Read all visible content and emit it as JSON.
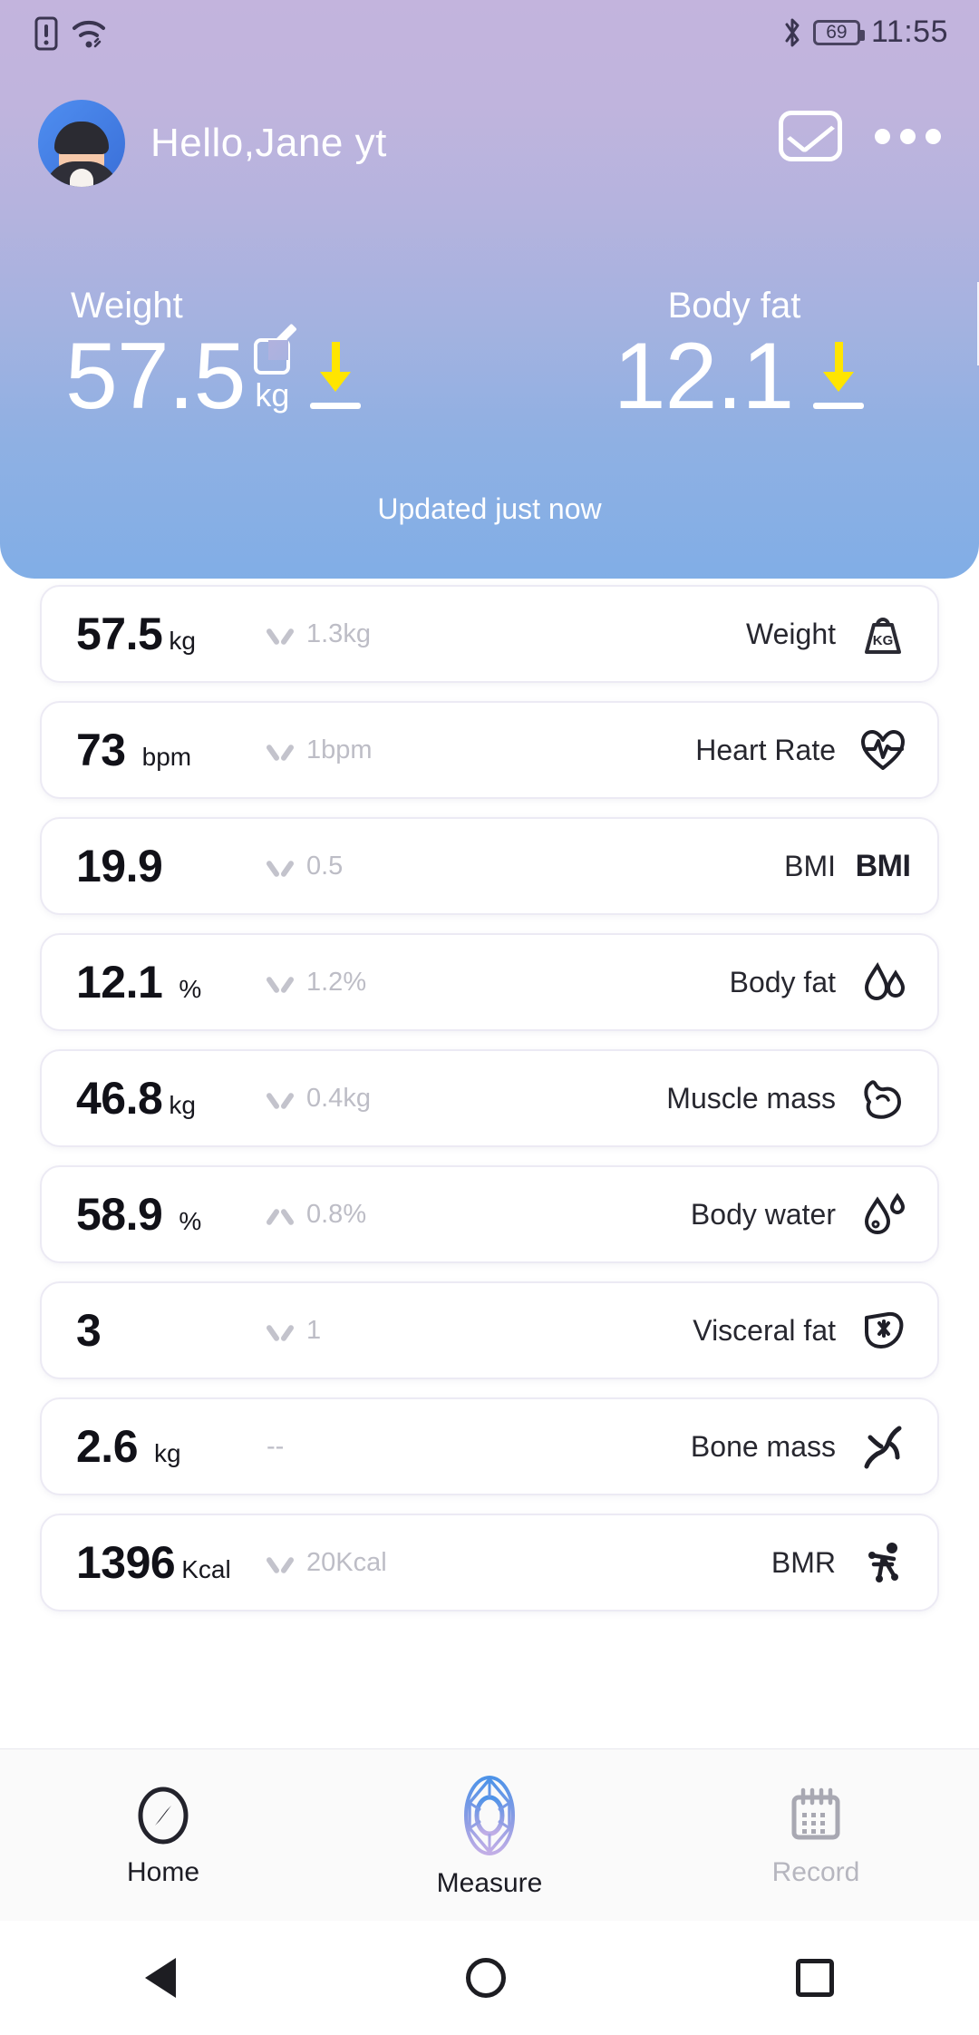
{
  "status_bar": {
    "time": "11:55",
    "battery_level": "69",
    "icons": [
      "sim-warning-icon",
      "wifi-icon",
      "bluetooth-icon",
      "battery-icon"
    ]
  },
  "header": {
    "greeting": "Hello,Jane yt",
    "avatar_icon": "user-avatar",
    "mail_icon": "envelope-icon",
    "more_icon": "more-options-icon"
  },
  "summary": {
    "weight": {
      "label": "Weight",
      "value": "57.5",
      "unit": "kg",
      "trend": "down",
      "edit_icon": "edit-pencil-icon"
    },
    "body_fat": {
      "label": "Body fat",
      "value": "12.1",
      "trend": "down"
    },
    "updated_text": "Updated just now",
    "accent_arrow_color": "#ffe500"
  },
  "metrics": [
    {
      "value": "57.5",
      "unit": "kg",
      "trend": "down",
      "delta": "1.3kg",
      "label": "Weight",
      "icon": "kg-weight-icon"
    },
    {
      "value": "73",
      "unit": "bpm",
      "trend": "down",
      "delta": "1bpm",
      "label": "Heart Rate",
      "icon": "heart-pulse-icon"
    },
    {
      "value": "19.9",
      "unit": "",
      "trend": "down",
      "delta": "0.5",
      "label": "BMI",
      "icon": "bmi-text-icon"
    },
    {
      "value": "12.1",
      "unit": "%",
      "trend": "down",
      "delta": "1.2%",
      "label": "Body fat",
      "icon": "fat-drops-icon"
    },
    {
      "value": "46.8",
      "unit": "kg",
      "trend": "down",
      "delta": "0.4kg",
      "label": "Muscle mass",
      "icon": "bicep-icon"
    },
    {
      "value": "58.9",
      "unit": "%",
      "trend": "up",
      "delta": "0.8%",
      "label": "Body water",
      "icon": "water-drop-icon"
    },
    {
      "value": "3",
      "unit": "",
      "trend": "down",
      "delta": "1",
      "label": "Visceral fat",
      "icon": "liver-icon"
    },
    {
      "value": "2.6",
      "unit": "kg",
      "trend": "none",
      "delta": "--",
      "label": "Bone mass",
      "icon": "bone-skeleton-icon"
    },
    {
      "value": "1396",
      "unit": "Kcal",
      "trend": "down",
      "delta": "20Kcal",
      "label": "BMR",
      "icon": "bmr-body-icon"
    }
  ],
  "bottom_nav": [
    {
      "label": "Home",
      "icon": "compass-icon",
      "state": "active"
    },
    {
      "label": "Measure",
      "icon": "measure-gem-icon",
      "state": "measure"
    },
    {
      "label": "Record",
      "icon": "calendar-icon",
      "state": "inactive"
    }
  ],
  "system_nav": {
    "back_icon": "back-triangle-icon",
    "home_icon": "home-circle-icon",
    "recents_icon": "recents-square-icon"
  }
}
